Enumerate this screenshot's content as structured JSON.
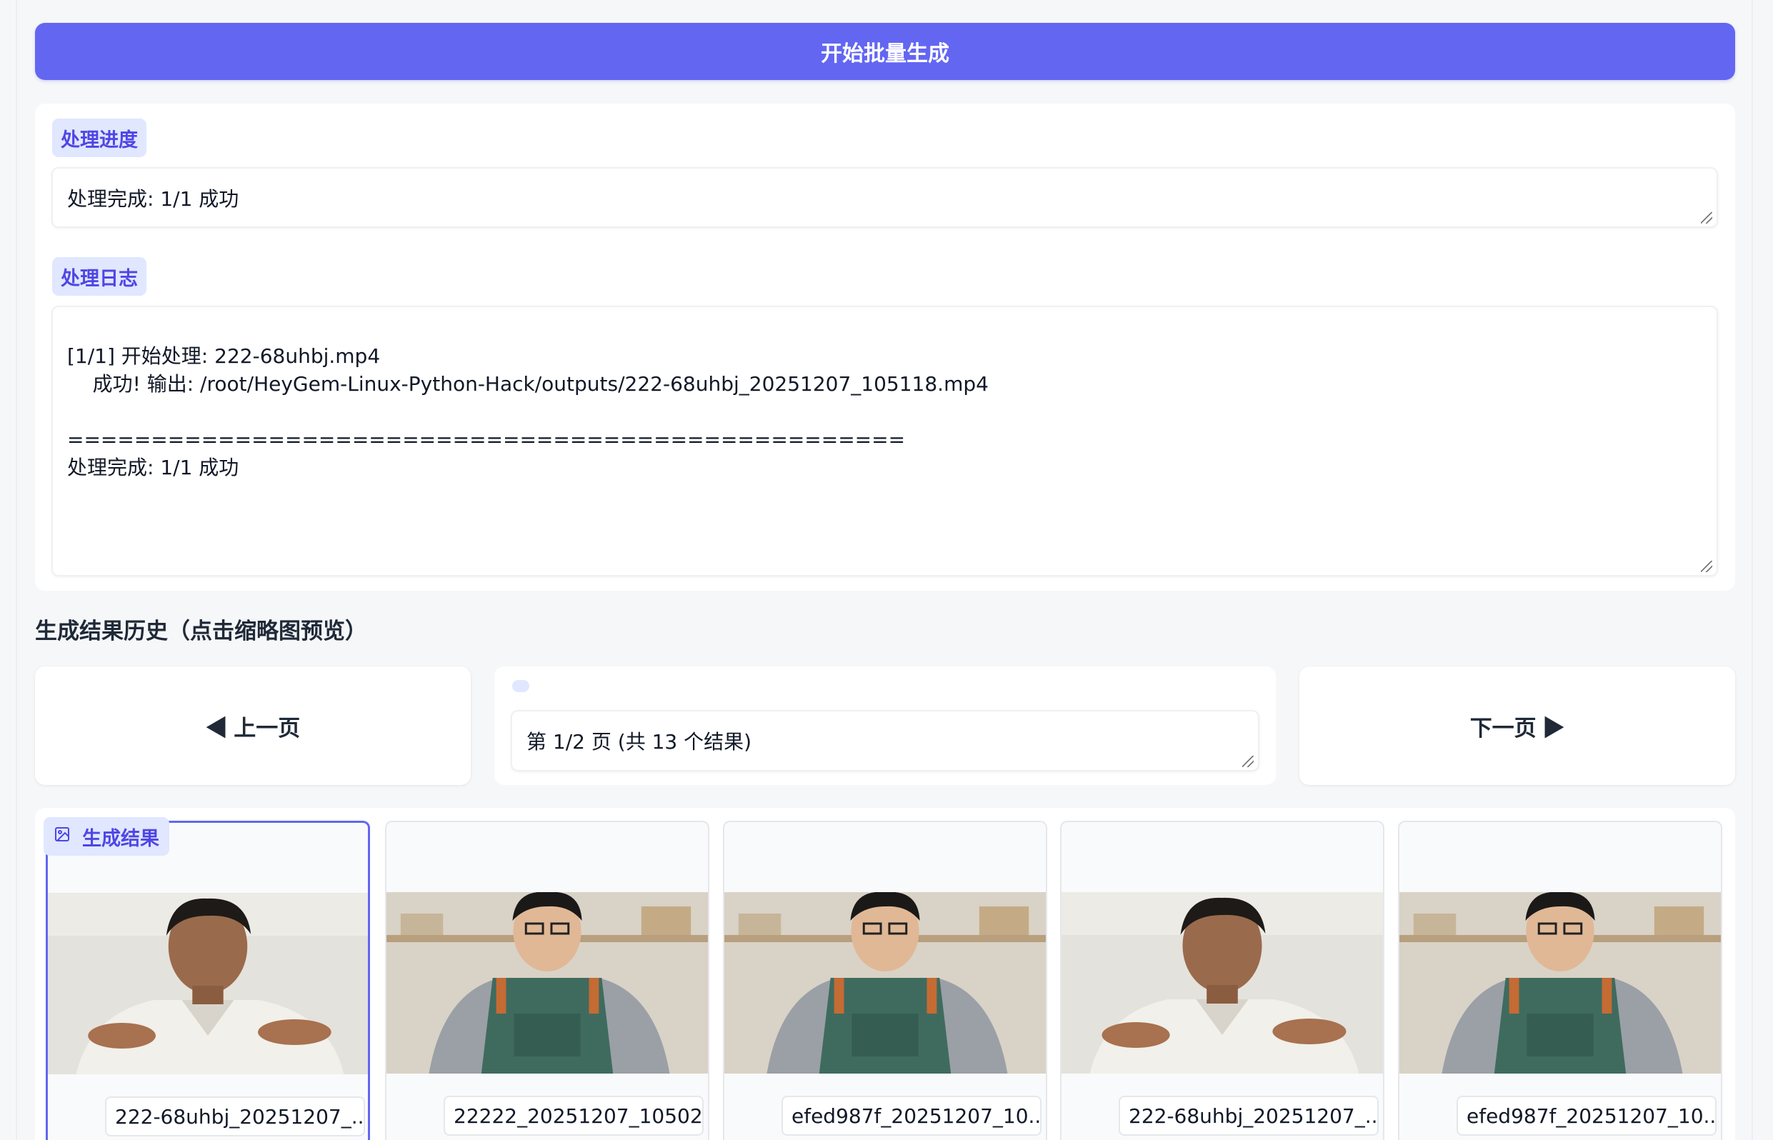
{
  "actions": {
    "start_batch_label": "开始批量生成"
  },
  "progress": {
    "label": "处理进度",
    "value": "处理完成: 1/1 成功"
  },
  "log": {
    "label": "处理日志",
    "text": "\n[1/1] 开始处理: 222-68uhbj.mp4\n    成功! 输出: /root/HeyGem-Linux-Python-Hack/outputs/222-68uhbj_20251207_105118.mp4\n\n==================================================\n处理完成: 1/1 成功"
  },
  "history": {
    "title": "生成结果历史（点击缩略图预览）",
    "prev_label": "◀ 上一页",
    "next_label": "下一页 ▶",
    "page_info": "第 1/2 页 (共 13 个结果)"
  },
  "gallery": {
    "label": "生成结果",
    "icon": "image-icon",
    "items": [
      {
        "caption": "222-68uhbj_20251207_...",
        "subject": "man-white-shirt",
        "selected": true
      },
      {
        "caption": "22222_20251207_10502...",
        "subject": "man-green-apron",
        "selected": false
      },
      {
        "caption": "efed987f_20251207_10...",
        "subject": "man-green-apron",
        "selected": false
      },
      {
        "caption": "222-68uhbj_20251207_...",
        "subject": "man-white-shirt",
        "selected": false
      },
      {
        "caption": "efed987f_20251207_10...",
        "subject": "man-green-apron",
        "selected": false
      }
    ]
  },
  "colors": {
    "accent": "#6366f1",
    "chip_bg": "#e0e7ff",
    "chip_text": "#4f46e5"
  }
}
